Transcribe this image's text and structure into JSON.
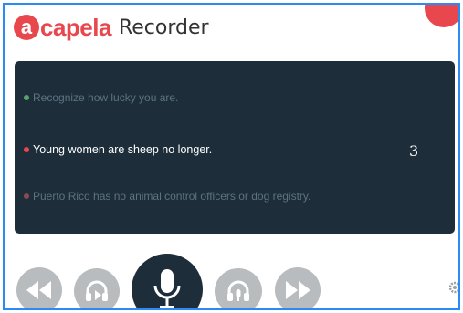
{
  "app": {
    "logo_initial": "a",
    "logo_rest": "capela",
    "product": "Recorder"
  },
  "colors": {
    "brand_red": "#e8474d",
    "panel_bg": "#1d2d39",
    "window_border": "#2a8bf2",
    "control_gray": "#b8bcbe"
  },
  "sentences": [
    {
      "text": "Recognize how lucky you are.",
      "status": "green"
    },
    {
      "text": "Young women are sheep no longer.",
      "status": "current"
    },
    {
      "text": "Puerto Rico has no animal control officers or dog registry.",
      "status": "pending"
    }
  ],
  "counter": "3",
  "controls": [
    "rewind-icon",
    "headphones-play-icon",
    "microphone-icon",
    "headphones-record-icon",
    "fast-forward-icon",
    "gear-icon"
  ]
}
